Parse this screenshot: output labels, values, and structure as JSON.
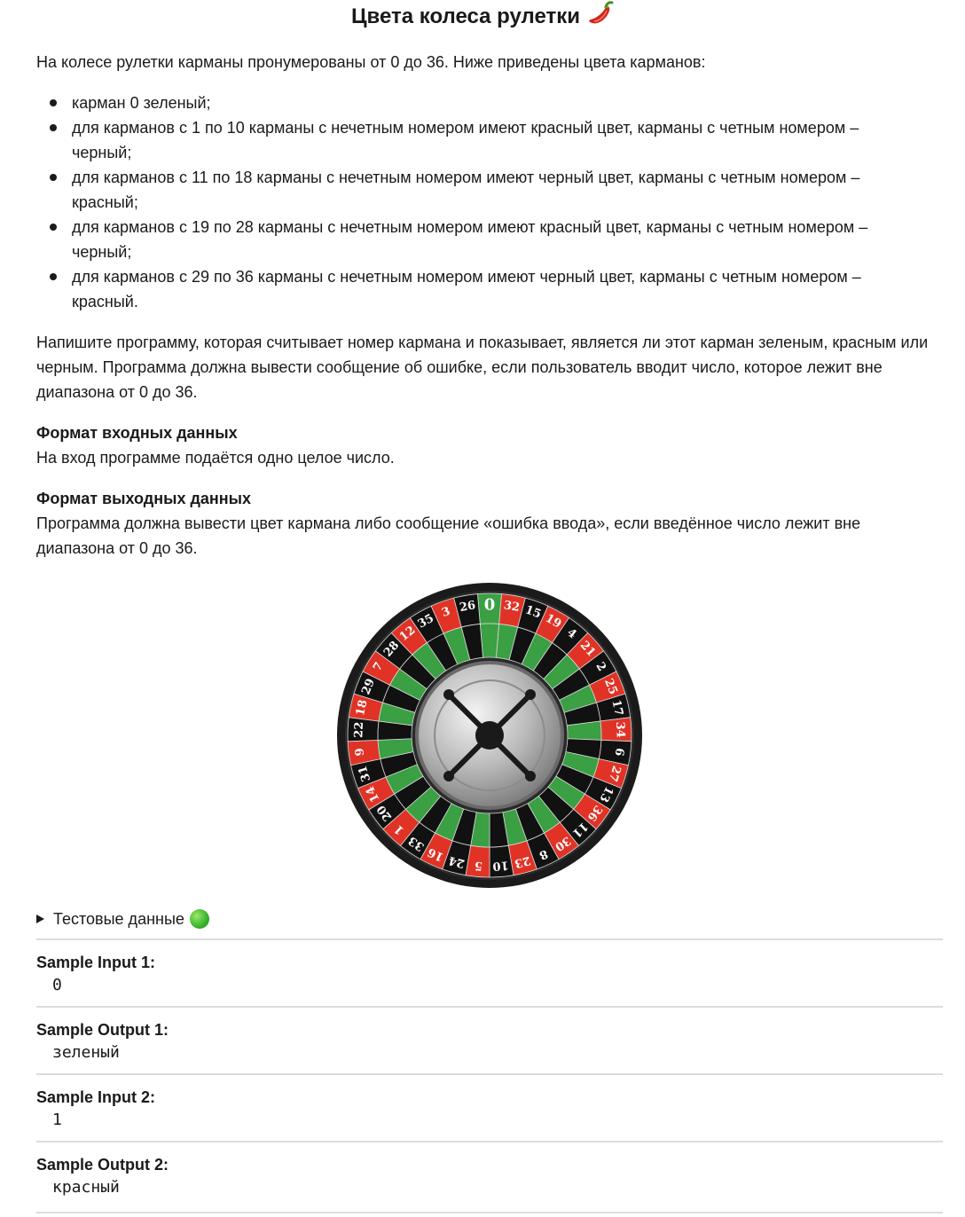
{
  "title": "Цвета колеса рулетки",
  "intro": "На колесе рулетки карманы пронумерованы от 0 до 36. Ниже приведены цвета карманов:",
  "rules": [
    "карман 0 зеленый;",
    "для карманов с 1 по 10 карманы с нечетным номером имеют красный цвет, карманы с четным номером – черный;",
    "для карманов с 11 по 18 карманы с нечетным номером имеют черный цвет, карманы с четным номером – красный;",
    "для карманов с 19 по 28 карманы с нечетным номером имеют красный цвет, карманы с четным номером – черный;",
    "для карманов с 29 по 36 карманы с нечетным номером имеют черный цвет, карманы с четным номером – красный."
  ],
  "task": "Напишите программу, которая считывает номер кармана и показывает, является ли этот карман зеленым, красным или черным. Программа должна вывести сообщение об ошибке, если пользователь вводит число, которое лежит вне диапазона от 0 до 36.",
  "input_format": {
    "heading": "Формат входных данных",
    "text": "На вход программе подаётся одно целое число."
  },
  "output_format": {
    "heading": "Формат выходных данных",
    "text": "Программа должна вывести цвет кармана либо сообщение «ошибка ввода», если введённое число лежит вне диапазона от 0 до 36."
  },
  "wheel": {
    "pockets": [
      "0",
      "32",
      "15",
      "19",
      "4",
      "21",
      "2",
      "25",
      "17",
      "34",
      "6",
      "27",
      "13",
      "36",
      "11",
      "30",
      "8",
      "23",
      "10",
      "5",
      "24",
      "16",
      "33",
      "1",
      "20",
      "14",
      "31",
      "9",
      "22",
      "18",
      "29",
      "7",
      "28",
      "12",
      "35",
      "3",
      "26"
    ],
    "colors": {
      "green": "#3aa043",
      "red": "#e03326",
      "black": "#111111"
    }
  },
  "tests_summary": "Тестовые данные",
  "samples": [
    {
      "label": "Sample Input 1:",
      "value": "0"
    },
    {
      "label": "Sample Output 1:",
      "value": "зеленый"
    },
    {
      "label": "Sample Input 2:",
      "value": "1"
    },
    {
      "label": "Sample Output 2:",
      "value": "красный"
    }
  ]
}
